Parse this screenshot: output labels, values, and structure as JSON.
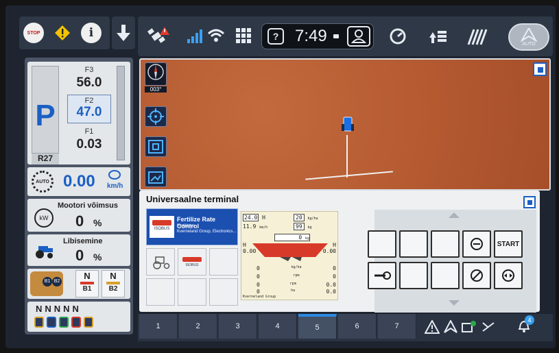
{
  "header": {
    "stop_label": "STOP",
    "clock": "7:49",
    "auto_label": "AUTO"
  },
  "gear_display": {
    "park": "P",
    "f3_label": "F3",
    "f3_value": "56.0",
    "f2_label": "F2",
    "f2_value": "47.0",
    "f1_label": "F1",
    "f1_value": "0.03",
    "range": "R27"
  },
  "speed": {
    "auto_label": "AUTO",
    "value": "0.00",
    "unit": "km/h"
  },
  "engine_power": {
    "title": "Mootori võimsus",
    "icon_unit": "kW",
    "value": "0",
    "unit": "%"
  },
  "slip": {
    "title": "Libisemine",
    "value": "0",
    "unit": "%"
  },
  "hitch": {
    "b1_label": "B1",
    "b2_label": "B2",
    "n": "N",
    "pto_label": "NNNNN"
  },
  "map": {
    "compass_heading": "003°"
  },
  "terminal": {
    "title": "Universaalne terminal",
    "implement_name": "Fertilize Rate Control",
    "implement_line2": "Fertilizers",
    "implement_line3": "Kverneland Group, Electronics...",
    "iso_label": "ISOBUS",
    "width_value": "24.0",
    "width_unit": "H",
    "time_value": "11.9",
    "time_unit": "km/h",
    "rate_target": "20",
    "rate_target_unit": "kg/ha",
    "rate_pct": "99",
    "rate_pct_unit": "kg",
    "hopper_value": "0",
    "hopper_unit": "kg",
    "left_h": "H",
    "left_h_val": "0.00",
    "right_h": "H",
    "right_h_val": "0.00",
    "row1": [
      "0",
      "kg/ha",
      "0"
    ],
    "row2": [
      "0",
      "rpm",
      "0"
    ],
    "row3": [
      "0",
      "rpm",
      "0.0"
    ],
    "row4": [
      "0",
      "ha",
      "0.0"
    ],
    "footer": "Kverneland Group",
    "start_label": "START"
  },
  "bottom_tabs": [
    "1",
    "2",
    "3",
    "4",
    "5",
    "6",
    "7"
  ],
  "notifications": {
    "count": "4"
  },
  "colors": {
    "accent_blue": "#2b8ae6",
    "speed_blue": "#1b5fc4",
    "warning_yellow": "#f2c200",
    "map_soil": "#b55a31"
  }
}
